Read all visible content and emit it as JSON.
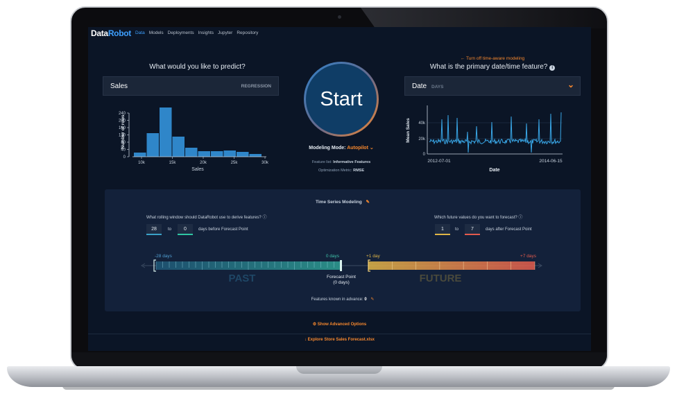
{
  "nav": {
    "logo_data": "Data",
    "logo_robot": "Robot",
    "items": [
      "Data",
      "Models",
      "Deployments",
      "Insights",
      "Jupyter",
      "Repository"
    ]
  },
  "target": {
    "question": "What would you like to predict?",
    "value": "Sales",
    "type": "REGRESSION"
  },
  "histogram": {
    "ylabel": "Number of rows",
    "xlabel": "Sales",
    "yticks": [
      "240",
      "200",
      "160",
      "120",
      "80",
      "40",
      "0"
    ],
    "xticks": [
      "10k",
      "15k",
      "20k",
      "25k",
      "30k"
    ]
  },
  "start": {
    "label": "Start",
    "modeling_mode_label": "Modeling Mode:",
    "modeling_mode_value": "Autopilot",
    "feature_list_label": "Feature list:",
    "feature_list_value": "Informative Features",
    "metric_label": "Optimization Metric:",
    "metric_value": "RMSE"
  },
  "time_aware": {
    "turn_off": "Turn off time-aware modeling",
    "question": "What is the primary date/time feature?",
    "value": "Date",
    "type": "DAYS"
  },
  "timeseries_chart": {
    "ylabel": "Mean Sales",
    "xlabel": "Date",
    "yticks": [
      "40k",
      "20k",
      "0"
    ],
    "xticks": [
      "2012-07-01",
      "2014-06-15"
    ]
  },
  "ts_modeling": {
    "title": "Time Series Modeling",
    "rolling_question": "What rolling window should DataRobot use to derive features?",
    "rolling_from": "28",
    "rolling_to_word": "to",
    "rolling_to": "0",
    "rolling_suffix": "days before Forecast Point",
    "forecast_question": "Which future values do you want to forecast?",
    "forecast_from": "1",
    "forecast_to_word": "to",
    "forecast_to": "7",
    "forecast_suffix": "days after Forecast Point",
    "past_start": "-28 days",
    "past_end": "0 days",
    "future_start": "+1 day",
    "future_end": "+7 days",
    "past_label": "PAST",
    "future_label": "FUTURE",
    "forecast_point": "Forecast Point",
    "forecast_point_sub": "(0 days)",
    "known_label": "Features known in advance:",
    "known_value": "0"
  },
  "footer": {
    "advanced": "Show Advanced Options",
    "explore": "Explore Store Sales Forecast.xlsx"
  },
  "colors": {
    "accent_blue": "#3ea0ff",
    "accent_orange": "#f7882e",
    "background": "#0b1526"
  }
}
